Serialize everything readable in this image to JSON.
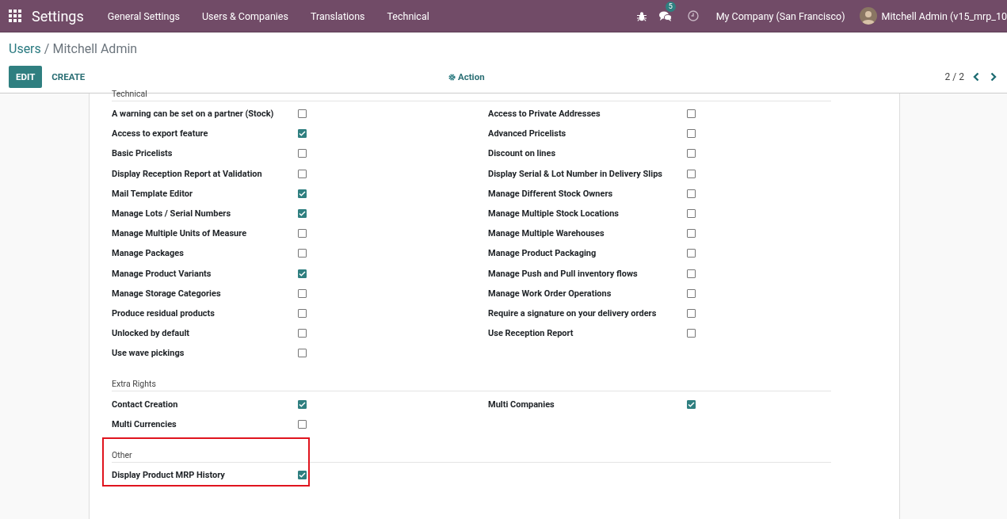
{
  "navbar": {
    "app_title": "Settings",
    "menu": [
      "General Settings",
      "Users & Companies",
      "Translations",
      "Technical"
    ],
    "messages_count": "5",
    "company": "My Company (San Francisco)",
    "user": "Mitchell Admin (v15_mrp_10"
  },
  "breadcrumb": {
    "parent": "Users",
    "separator": "/",
    "current": "Mitchell Admin"
  },
  "buttons": {
    "edit": "EDIT",
    "create": "CREATE",
    "action": "Action"
  },
  "pager": "2 / 2",
  "sections": [
    {
      "title": "Technical",
      "highlighted": false,
      "items": [
        {
          "label": "A warning can be set on a partner (Stock)",
          "checked": false
        },
        {
          "label": "Access to Private Addresses",
          "checked": false
        },
        {
          "label": "Access to export feature",
          "checked": true
        },
        {
          "label": "Advanced Pricelists",
          "checked": false
        },
        {
          "label": "Basic Pricelists",
          "checked": false
        },
        {
          "label": "Discount on lines",
          "checked": false
        },
        {
          "label": "Display Reception Report at Validation",
          "checked": false
        },
        {
          "label": "Display Serial & Lot Number in Delivery Slips",
          "checked": false
        },
        {
          "label": "Mail Template Editor",
          "checked": true
        },
        {
          "label": "Manage Different Stock Owners",
          "checked": false
        },
        {
          "label": "Manage Lots / Serial Numbers",
          "checked": true
        },
        {
          "label": "Manage Multiple Stock Locations",
          "checked": false
        },
        {
          "label": "Manage Multiple Units of Measure",
          "checked": false
        },
        {
          "label": "Manage Multiple Warehouses",
          "checked": false
        },
        {
          "label": "Manage Packages",
          "checked": false
        },
        {
          "label": "Manage Product Packaging",
          "checked": false
        },
        {
          "label": "Manage Product Variants",
          "checked": true
        },
        {
          "label": "Manage Push and Pull inventory flows",
          "checked": false
        },
        {
          "label": "Manage Storage Categories",
          "checked": false
        },
        {
          "label": "Manage Work Order Operations",
          "checked": false
        },
        {
          "label": "Produce residual products",
          "checked": false
        },
        {
          "label": "Require a signature on your delivery orders",
          "checked": false
        },
        {
          "label": "Unlocked by default",
          "checked": false
        },
        {
          "label": "Use Reception Report",
          "checked": false
        },
        {
          "label": "Use wave pickings",
          "checked": false
        }
      ]
    },
    {
      "title": "Extra Rights",
      "highlighted": false,
      "items": [
        {
          "label": "Contact Creation",
          "checked": true
        },
        {
          "label": "Multi Companies",
          "checked": true
        },
        {
          "label": "Multi Currencies",
          "checked": false
        }
      ]
    },
    {
      "title": "Other",
      "highlighted": true,
      "items": [
        {
          "label": "Display Product MRP History",
          "checked": true
        }
      ]
    }
  ]
}
